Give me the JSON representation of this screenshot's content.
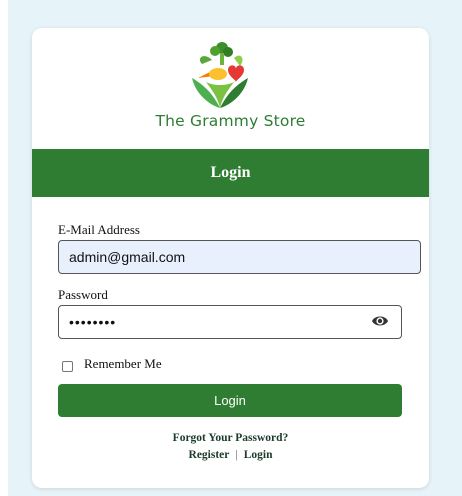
{
  "brand": {
    "name": "The Grammy Store",
    "accent": "#2e7d32"
  },
  "header": {
    "title": "Login"
  },
  "form": {
    "email_label": "E-Mail Address",
    "email_value": "admin@gmail.com",
    "password_label": "Password",
    "password_value": "••••••••",
    "remember_label": "Remember Me",
    "remember_checked": false,
    "submit_label": "Login"
  },
  "footer": {
    "forgot_label": "Forgot Your Password?",
    "register_label": "Register",
    "separator": "|",
    "login_label": "Login"
  },
  "icons": {
    "logo": "grocery-basket-logo",
    "toggle": "eye-icon"
  }
}
